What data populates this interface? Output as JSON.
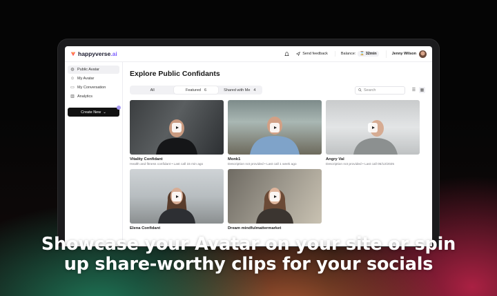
{
  "brand": {
    "name": "happyverse",
    "suffix": ".ai"
  },
  "topbar": {
    "notification_icon": "bell-icon",
    "feedback_label": "Send feedback",
    "balance_label": "Balance:",
    "balance_value": "32min",
    "user_name": "Jenny Wilson"
  },
  "sidebar": {
    "items": [
      {
        "label": "Public Avatar",
        "icon": "globe-icon"
      },
      {
        "label": "My Avatar",
        "icon": "user-icon"
      },
      {
        "label": "My Conversation",
        "icon": "chat-icon"
      },
      {
        "label": "Analytics",
        "icon": "chart-icon"
      }
    ],
    "create_label": "Create New"
  },
  "main": {
    "title": "Explore Public Confidants",
    "tabs": [
      {
        "label": "All",
        "count": ""
      },
      {
        "label": "Featured",
        "count": "6"
      },
      {
        "label": "Shared with Me",
        "count": "4"
      }
    ],
    "search_placeholder": "Search",
    "cards": [
      {
        "title": "Vitality Confidant",
        "subtitle": "Health and fitness confidant  •  Last call 15 min ago"
      },
      {
        "title": "Monk1",
        "subtitle": "Description not provided  •  Last call 1 week ago"
      },
      {
        "title": "Angry Val",
        "subtitle": "Description not provided  •  Last call 05/12/2025"
      },
      {
        "title": "Elena Confidant",
        "subtitle": ""
      },
      {
        "title": "Dream mindfulmattermarket",
        "subtitle": ""
      }
    ]
  },
  "caption": {
    "line1": "Showcase your Avatar on your site or spin",
    "line2": "up share-worthy clips for your socials"
  },
  "colors": {
    "accent": "#7b5cff",
    "background": "#050505"
  }
}
